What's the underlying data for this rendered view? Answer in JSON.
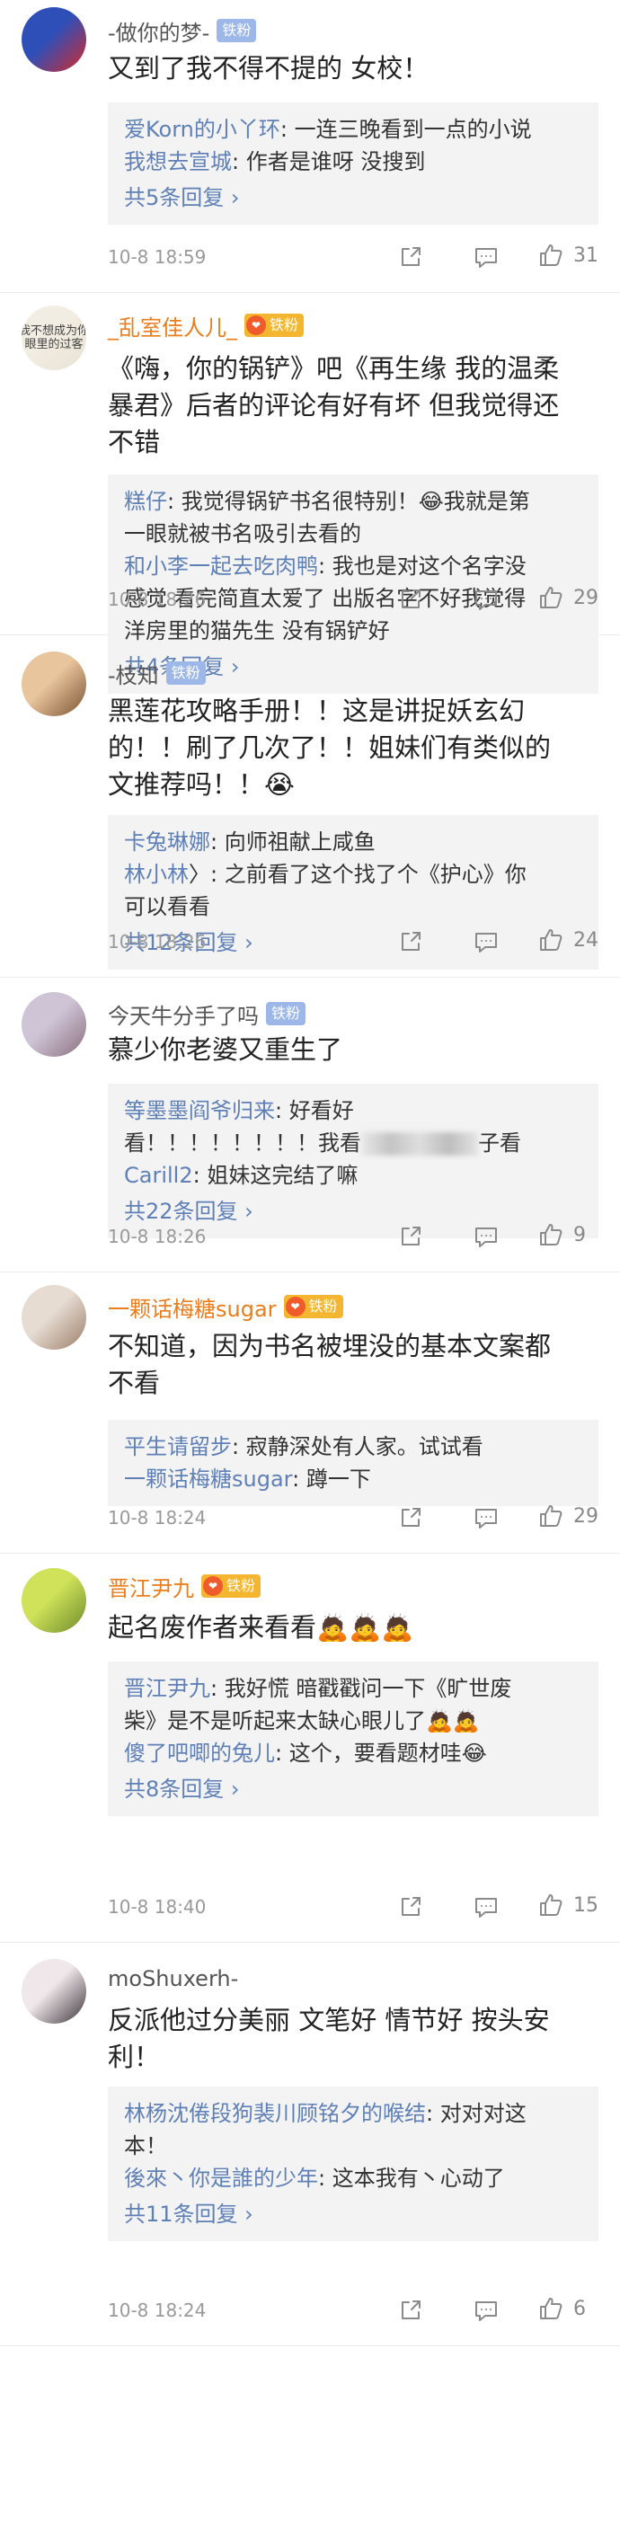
{
  "comments": [
    {
      "user": "-做你的梦-",
      "badge": "铁粉",
      "badge_style": "blue",
      "name_style": "gray",
      "avatar": {
        "colors": [
          "#2f4fb8",
          "#d42a2a"
        ],
        "label": ""
      },
      "lines": [
        "又到了我不得不提的 女校！"
      ],
      "replies": [
        {
          "segments": [
            {
              "text": "爱Korn的小丫环",
              "kind": "name"
            },
            {
              "text": ": 一连三晚看到一点的小说",
              "kind": "text"
            }
          ]
        },
        {
          "segments": [
            {
              "text": "我想去宣城",
              "kind": "name"
            },
            {
              "text": ": 作者是谁呀 没搜到",
              "kind": "text"
            }
          ]
        }
      ],
      "more": "共5条回复 ›",
      "time": "10-8 18:59",
      "likes": "31"
    },
    {
      "user": "_乱室佳人儿_",
      "badge": "铁粉",
      "badge_style": "gold",
      "name_style": "orange",
      "avatar": {
        "colors": [
          "#f2ede2",
          "#e8e2d2"
        ],
        "label": "我不想成为你\n眼里的过客"
      },
      "lines": [
        "《嗨，你的锅铲》吧《再生缘 我的温柔",
        "暴君》后者的评论有好有坏 但我觉得还",
        "不错"
      ],
      "replies": [
        {
          "segments": [
            {
              "text": "糕仔",
              "kind": "name"
            },
            {
              "text": ": 我觉得锅铲书名很特别！😂我就是第",
              "kind": "text"
            }
          ]
        },
        {
          "segments": [
            {
              "text": "一眼就被书名吸引去看的",
              "kind": "text"
            }
          ]
        },
        {
          "segments": [
            {
              "text": "和小李一起去吃肉鸭",
              "kind": "name"
            },
            {
              "text": ": 我也是对这个名字没",
              "kind": "text"
            }
          ]
        },
        {
          "segments": [
            {
              "text": "感觉  看完简直太爱了  出版名字不好我觉得",
              "kind": "text"
            }
          ]
        },
        {
          "segments": [
            {
              "text": "洋房里的猫先生  没有锅铲好",
              "kind": "text"
            }
          ]
        }
      ],
      "more": "共4条回复 ›",
      "time": "10-8 18:26",
      "likes": "29"
    },
    {
      "user": "-枝知",
      "badge": "铁粉",
      "badge_style": "blue",
      "name_style": "gray",
      "avatar": {
        "colors": [
          "#e9c59d",
          "#7a5232"
        ],
        "label": ""
      },
      "lines": [
        "黑莲花攻略手册！！这是讲捉妖玄幻",
        "的！！刷了几次了！！姐妹们有类似的",
        "文推荐吗！！😭"
      ],
      "replies": [
        {
          "segments": [
            {
              "text": "卡兔琳娜",
              "kind": "name"
            },
            {
              "text": ": 向师祖献上咸鱼",
              "kind": "text"
            }
          ]
        },
        {
          "segments": [
            {
              "text": "林小林",
              "kind": "name"
            },
            {
              "text": "〉: 之前看了这个找了个《护心》你",
              "kind": "text"
            }
          ]
        },
        {
          "segments": [
            {
              "text": "可以看看",
              "kind": "text"
            }
          ]
        }
      ],
      "more": "共12条回复 ›",
      "time": "10-8 18:26",
      "likes": "24"
    },
    {
      "user": "今天牛分手了吗",
      "badge": "铁粉",
      "badge_style": "blue",
      "name_style": "gray",
      "avatar": {
        "colors": [
          "#cfc4d6",
          "#8a6f7e"
        ],
        "label": ""
      },
      "lines": [
        "慕少你老婆又重生了"
      ],
      "replies": [
        {
          "segments": [
            {
              "text": "等墨墨阎爷归来",
              "kind": "name"
            },
            {
              "text": ": 好看好",
              "kind": "text"
            }
          ]
        },
        {
          "segments": [
            {
              "text": "看！！！！！！！！我看",
              "kind": "text"
            },
            {
              "text": "",
              "kind": "blur"
            },
            {
              "text": "子看",
              "kind": "text"
            }
          ]
        },
        {
          "segments": [
            {
              "text": "Carill2",
              "kind": "name"
            },
            {
              "text": ": 姐妹这完结了嘛",
              "kind": "text"
            }
          ]
        }
      ],
      "more": "共22条回复 ›",
      "time": "10-8 18:26",
      "likes": "9"
    },
    {
      "user": "一颗话梅糖sugar",
      "badge": "铁粉",
      "badge_style": "gold",
      "name_style": "orange",
      "avatar": {
        "colors": [
          "#e6dcd2",
          "#9c7d68"
        ],
        "label": ""
      },
      "lines": [
        "不知道，因为书名被埋没的基本文案都",
        "不看"
      ],
      "replies": [
        {
          "segments": [
            {
              "text": "平生请留步",
              "kind": "name"
            },
            {
              "text": ": 寂静深处有人家。试试看",
              "kind": "text"
            }
          ]
        },
        {
          "segments": [
            {
              "text": "一颗话梅糖sugar",
              "kind": "name"
            },
            {
              "text": ": 蹲一下",
              "kind": "text"
            }
          ]
        }
      ],
      "more": "",
      "time": "10-8 18:24",
      "likes": "29"
    },
    {
      "user": "晋江尹九",
      "badge": "铁粉",
      "badge_style": "gold",
      "name_style": "orange",
      "avatar": {
        "colors": [
          "#cfe25a",
          "#6d8a2a"
        ],
        "label": ""
      },
      "lines": [
        "起名废作者来看看🙇🙇🙇"
      ],
      "replies": [
        {
          "segments": [
            {
              "text": "晋江尹九",
              "kind": "name"
            },
            {
              "text": ": 我好慌 暗戳戳问一下《旷世废",
              "kind": "text"
            }
          ]
        },
        {
          "segments": [
            {
              "text": "柴》是不是听起来太缺心眼儿了🙇🙇",
              "kind": "text"
            }
          ]
        },
        {
          "segments": [
            {
              "text": "傻了吧唧的兔儿",
              "kind": "name"
            },
            {
              "text": ": 这个，要看题材哇😂",
              "kind": "text"
            }
          ]
        }
      ],
      "more": "共8条回复 ›",
      "time": "10-8 18:40",
      "likes": "15"
    },
    {
      "user": "moShuxerh-",
      "badge": "",
      "badge_style": "none",
      "name_style": "gray",
      "avatar": {
        "colors": [
          "#efe7ea",
          "#3c3438"
        ],
        "label": ""
      },
      "lines": [
        "反派他过分美丽 文笔好 情节好  按头安",
        "利！"
      ],
      "replies": [
        {
          "segments": [
            {
              "text": "林杨沈倦段狗裴川顾铭夕的喉结",
              "kind": "name"
            },
            {
              "text": ": 对对对这",
              "kind": "text"
            }
          ]
        },
        {
          "segments": [
            {
              "text": "本！",
              "kind": "text"
            }
          ]
        },
        {
          "segments": [
            {
              "text": "後來丶你是誰的少年",
              "kind": "name"
            },
            {
              "text": ": 这本我有丶心动了",
              "kind": "text"
            }
          ]
        }
      ],
      "more": "共11条回复 ›",
      "time": "10-8 18:24",
      "likes": "6"
    }
  ]
}
